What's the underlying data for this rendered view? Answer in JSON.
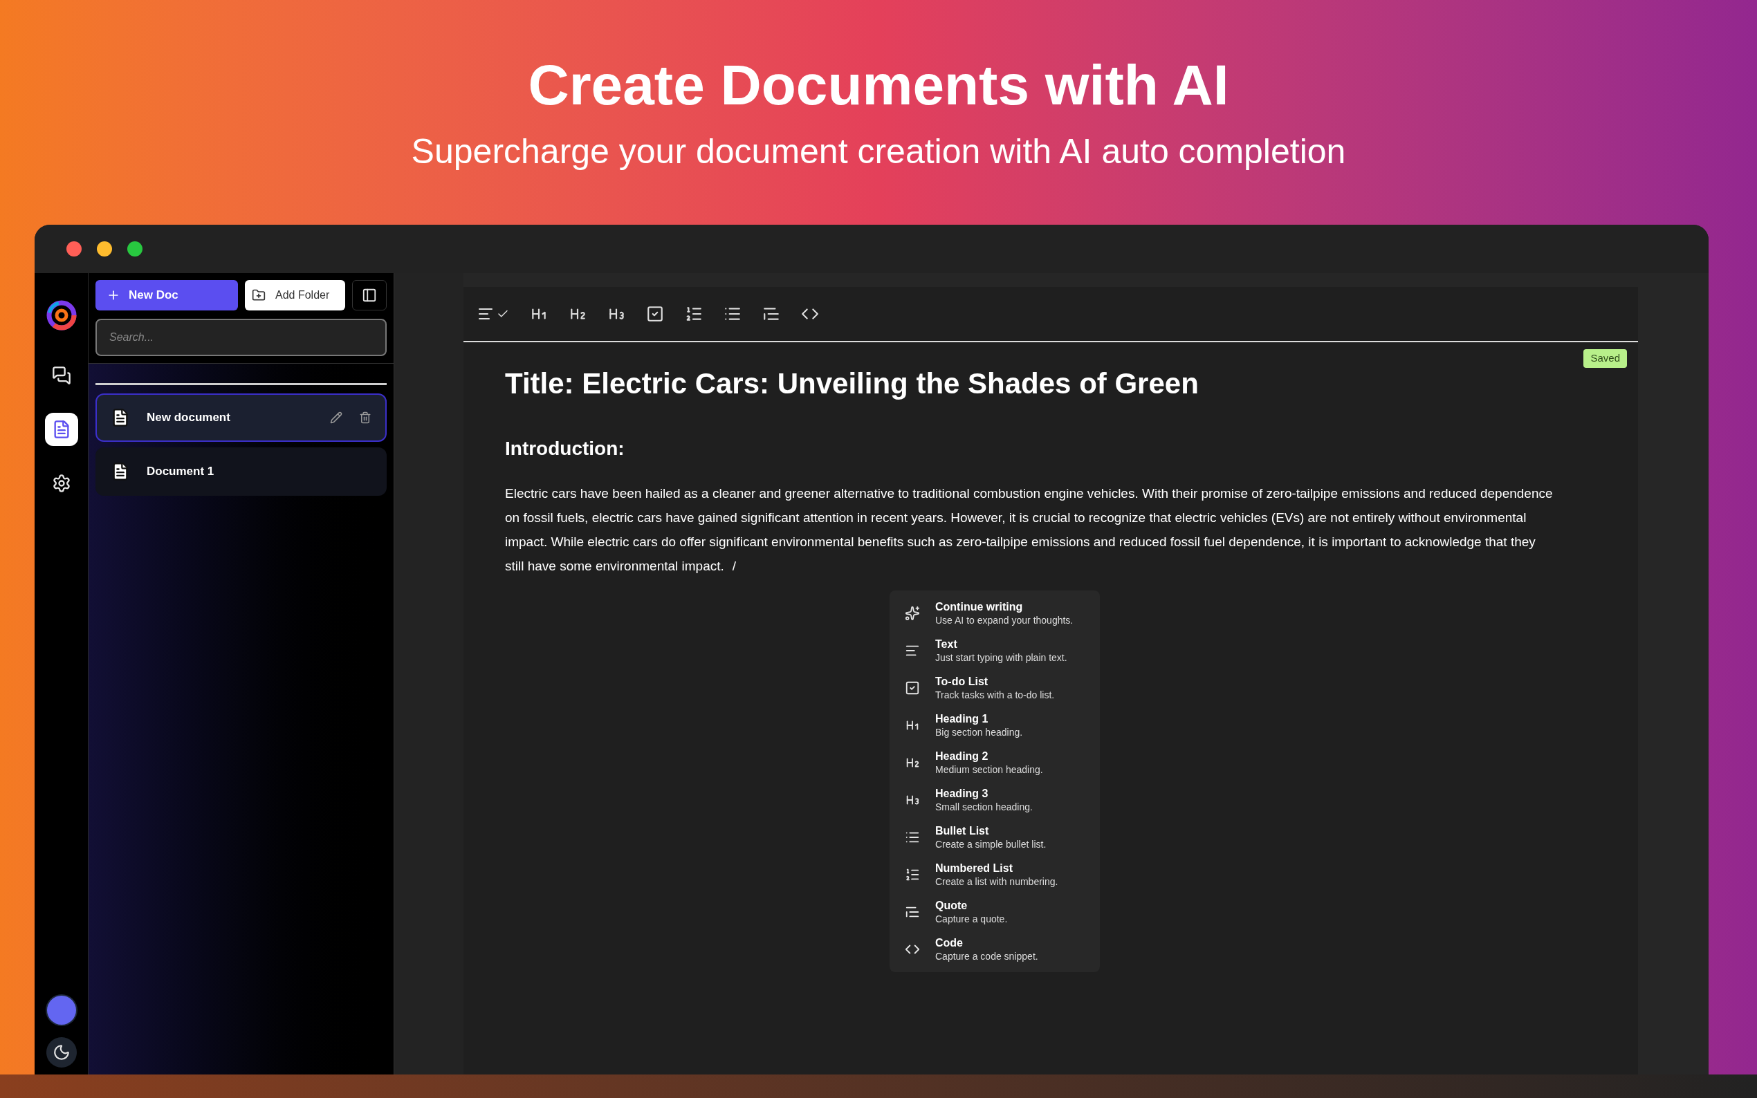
{
  "hero": {
    "title": "Create Documents with AI",
    "subtitle": "Supercharge your document creation with AI auto completion"
  },
  "rail": {
    "items": [
      {
        "kind": "chat",
        "selected": false
      },
      {
        "kind": "docs",
        "selected": true
      },
      {
        "kind": "settings",
        "selected": false
      }
    ]
  },
  "sidebar": {
    "new_button": "New Doc",
    "folder_button": "Add Folder",
    "search": {
      "placeholder": "Search..."
    },
    "documents": [
      {
        "name": "New document",
        "selected": true
      },
      {
        "name": "Document 1",
        "selected": false
      }
    ]
  },
  "editor": {
    "status": "Saved",
    "title": "Title: Electric Cars: Unveiling the Shades of Green",
    "heading": "Introduction:",
    "paragraph": "Electric cars have been hailed as a cleaner and greener alternative to traditional combustion engine vehicles. With their promise of zero-tailpipe emissions and reduced dependence on fossil fuels, electric cars have gained significant attention in recent years. However, it is crucial to recognize that electric vehicles (EVs) are not entirely without environmental impact. While electric cars do offer significant environmental benefits such as zero-tailpipe emissions and reduced fossil fuel dependence, it is important to acknowledge that they still have some environmental impact.",
    "slash": "/"
  },
  "command_menu": [
    {
      "kind": "ai",
      "title": "Continue writing",
      "description": "Use AI to expand your thoughts."
    },
    {
      "kind": "text",
      "title": "Text",
      "description": "Just start typing with plain text."
    },
    {
      "kind": "todo",
      "title": "To-do List",
      "description": "Track tasks with a to-do list."
    },
    {
      "kind": "h1",
      "title": "Heading 1",
      "description": "Big section heading."
    },
    {
      "kind": "h2",
      "title": "Heading 2",
      "description": "Medium section heading."
    },
    {
      "kind": "h3",
      "title": "Heading 3",
      "description": "Small section heading."
    },
    {
      "kind": "bullet",
      "title": "Bullet List",
      "description": "Create a simple bullet list."
    },
    {
      "kind": "numbered",
      "title": "Numbered List",
      "description": "Create a list with numbering."
    },
    {
      "kind": "quote",
      "title": "Quote",
      "description": "Capture a quote."
    },
    {
      "kind": "code",
      "title": "Code",
      "description": "Capture a code snippet."
    }
  ]
}
